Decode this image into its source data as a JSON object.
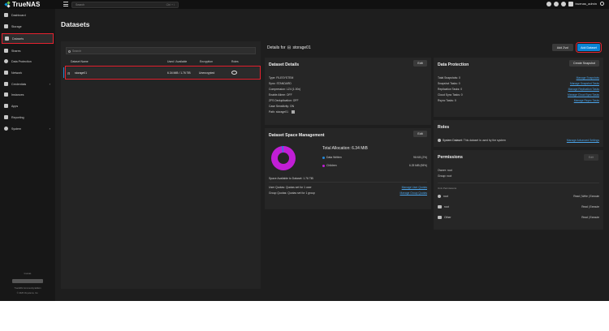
{
  "app": {
    "logo_text": "TrueNAS",
    "brand_colors": [
      "#0095d5",
      "#71bf44",
      "#e9e9e9"
    ],
    "accent": "#0a84d6"
  },
  "topbar": {
    "search_placeholder": "Search",
    "search_shortcut": "Ctrl + /",
    "username": "truenas_admin"
  },
  "sidebar": {
    "items": [
      {
        "label": "Dashboard",
        "icon": "dashboard-icon"
      },
      {
        "label": "Storage",
        "icon": "storage-icon"
      },
      {
        "label": "Datasets",
        "icon": "datasets-icon",
        "active": true
      },
      {
        "label": "Shares",
        "icon": "shares-icon"
      },
      {
        "label": "Data Protection",
        "icon": "shield-icon"
      },
      {
        "label": "Network",
        "icon": "network-icon"
      },
      {
        "label": "Credentials",
        "icon": "key-icon",
        "expandable": true
      },
      {
        "label": "Instances",
        "icon": "instances-icon"
      },
      {
        "label": "Apps",
        "icon": "apps-icon"
      },
      {
        "label": "Reporting",
        "icon": "chart-icon"
      },
      {
        "label": "System",
        "icon": "gear-icon",
        "expandable": true
      }
    ],
    "footer_hostname": "truenas",
    "footer_edition": "TrueNAS Community Edition",
    "footer_copyright": "© 2025 iXsystems, Inc."
  },
  "page": {
    "title": "Datasets"
  },
  "list": {
    "search_placeholder": "Search",
    "columns": [
      "Dataset Name",
      "Used / Available",
      "Encryption",
      "Roles"
    ],
    "rows": [
      {
        "name": "storage01",
        "used": "6.34 MiB / 1.76 TiB",
        "encryption": "Unencrypted"
      }
    ]
  },
  "details": {
    "label": "Details for",
    "name": "storage01",
    "add_zvol": "Add Zvol",
    "add_dataset": "Add Dataset"
  },
  "dataset_details": {
    "title": "Dataset Details",
    "edit": "Edit",
    "rows": [
      {
        "k": "Type:",
        "v": "FILESYSTEM"
      },
      {
        "k": "Sync:",
        "v": "STANDARD"
      },
      {
        "k": "Compression:",
        "v": "LZ4 (1.00x)"
      },
      {
        "k": "Enable Atime:",
        "v": "OFF"
      },
      {
        "k": "ZFS Deduplication:",
        "v": "OFF"
      },
      {
        "k": "Case Sensitivity:",
        "v": "ON"
      },
      {
        "k": "Path:",
        "v": "storage01"
      }
    ]
  },
  "space": {
    "title": "Dataset Space Management",
    "edit": "Edit",
    "total_label": "Total Allocation:",
    "total_value": "6.34 MiB",
    "data_written_label": "Data Written",
    "data_written_value": "96 KiB (2%)",
    "data_written_fraction": 0.02,
    "children_label": "Children",
    "children_value": "6.25 MiB (98%)",
    "children_fraction": 0.98,
    "available": "Space Available to Dataset: 1.76 TiB",
    "user_quota": "User Quotas:",
    "user_quota_value": "Quotas set for 1 user",
    "user_quota_link": "Manage User Quotas",
    "group_quota": "Group Quotas:",
    "group_quota_value": "Quotas set for 1 group",
    "group_quota_link": "Manage Group Quotas"
  },
  "protection": {
    "title": "Data Protection",
    "create_snapshot": "Create Snapshot",
    "rows": [
      {
        "k": "Total Snapshots: 0",
        "link": "Manage Snapshots"
      },
      {
        "k": "Snapshot Tasks: 0",
        "link": "Manage Snapshot Tasks"
      },
      {
        "k": "Replication Tasks: 0",
        "link": "Manage Replication Tasks"
      },
      {
        "k": "Cloud Sync Tasks: 0",
        "link": "Manage Cloud Sync Tasks"
      },
      {
        "k": "Rsync Tasks: 0",
        "link": "Manage Rsync Tasks"
      }
    ]
  },
  "roles": {
    "title": "Roles",
    "system_dataset": "System Dataset:",
    "system_dataset_desc": "This dataset is used by the system",
    "link": "Manage Advanced Settings"
  },
  "permissions": {
    "title": "Permissions",
    "edit": "Edit",
    "owner": "Owner: root",
    "group": "Group: root",
    "unix_label": "Unix Permissions",
    "rows": [
      {
        "who": "root",
        "perm": "Read | Write | Execute"
      },
      {
        "who": "root",
        "perm": "Read | Execute"
      },
      {
        "who": "Other",
        "perm": "Read | Execute"
      }
    ]
  }
}
